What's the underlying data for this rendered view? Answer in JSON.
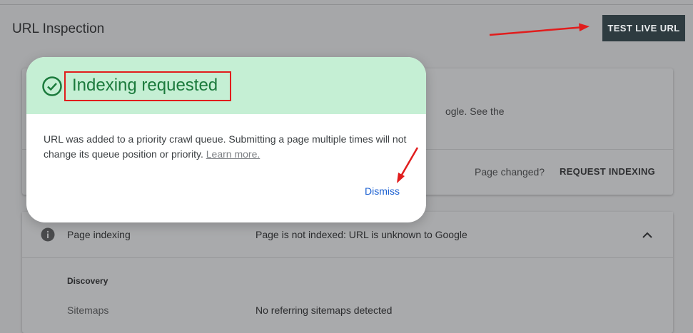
{
  "header": {
    "title": "URL Inspection",
    "test_live_label": "TEST LIVE URL"
  },
  "inspection_card": {
    "partial_text": "ogle. See the",
    "page_changed": "Page changed?",
    "request_indexing": "REQUEST INDEXING"
  },
  "indexing_card": {
    "label": "Page indexing",
    "value": "Page is not indexed: URL is unknown to Google",
    "section_title": "Discovery",
    "sitemaps_label": "Sitemaps",
    "sitemaps_value": "No referring sitemaps detected"
  },
  "dialog": {
    "title": "Indexing requested",
    "body": "URL was added to a priority crawl queue. Submitting a page multiple times will not change its queue position or priority.",
    "learn_more": "Learn more.",
    "dismiss": "Dismiss"
  },
  "colors": {
    "success_green": "#1b7a3c",
    "success_bg": "#c5efd4",
    "annotation_red": "#e11d1d",
    "link_blue": "#1a5fd1",
    "button_dark": "#2e3b40"
  },
  "icons": {
    "check": "check-circle-icon",
    "info": "info-icon",
    "chevron": "chevron-up-icon"
  }
}
